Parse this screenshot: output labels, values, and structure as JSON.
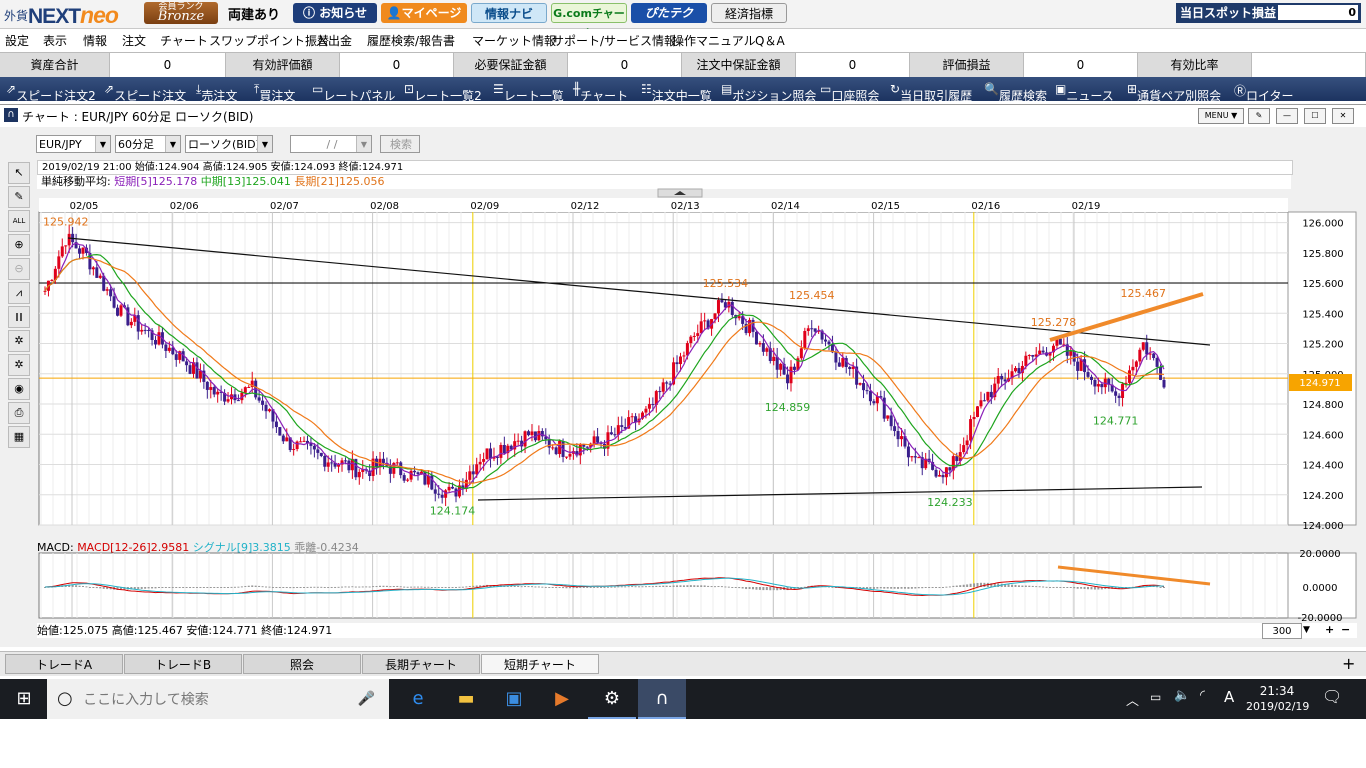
{
  "brand": {
    "prefix": "外貨",
    "name": "NEXT",
    "suffix": "neo",
    "rank_label": "会員ランク",
    "rank": "Bronze"
  },
  "position_state": "両建あり",
  "top_buttons": [
    "お知らせ",
    "マイページ",
    "情報ナビ",
    "G.comチャート",
    "ぴたテク",
    "経済指標"
  ],
  "spot": {
    "label": "当日スポット損益",
    "value": "0"
  },
  "menu": [
    "設定",
    "表示",
    "情報",
    "注文",
    "チャート",
    "スワップポイント振替",
    "入出金",
    "履歴検索/報告書",
    "マーケット情報",
    "サポート/サービス情報",
    "操作マニュアル",
    "Q＆A"
  ],
  "account_info": [
    {
      "label": "資産合計",
      "value": "0"
    },
    {
      "label": "有効評価額",
      "value": "0"
    },
    {
      "label": "必要保証金額",
      "value": "0"
    },
    {
      "label": "注文中保証金額",
      "value": "0"
    },
    {
      "label": "評価損益",
      "value": "0"
    },
    {
      "label": "有効比率",
      "value": ""
    }
  ],
  "toolbar": [
    "スピード注文2",
    "スピード注文",
    "売注文",
    "買注文",
    "レートパネル",
    "レート一覧2",
    "レート一覧",
    "チャート",
    "注文中一覧",
    "ポジション照会",
    "口座照会",
    "当日取引履歴",
    "履歴検索",
    "ニュース",
    "通貨ペア別照会",
    "ロイター"
  ],
  "chart_window": {
    "title": "チャート : EUR/JPY 60分足 ローソク(BID)",
    "menu_btn": "MENU ▼",
    "pair": "EUR/JPY",
    "timeframe": "60分足",
    "chart_type": "ローソク(BID)",
    "date": "/ /",
    "search": "検索",
    "ohlc_line": "2019/02/19 21:00  始値:124.904  高値:124.905  安値:124.093  終値:124.971",
    "ma_label": "単純移動平均:",
    "ma_short": "短期[5]125.178",
    "ma_mid": "中期[13]125.041",
    "ma_long": "長期[21]125.056",
    "macd_label": "MACD:",
    "macd_main": "MACD[12-26]2.9581",
    "macd_signal": "シグナル[9]3.3815",
    "macd_div": "乖離-0.4234",
    "bottom_ohlc": "始値:125.075  高値:125.467  安値:124.771  終値:124.971",
    "bars": "300"
  },
  "chart_data": {
    "type": "candlestick",
    "x_ticks": [
      "02/05",
      "02/06",
      "02/07",
      "02/08",
      "02/09",
      "02/12",
      "02/13",
      "02/14",
      "02/15",
      "02/16",
      "02/19"
    ],
    "y_ticks": [
      "126.000",
      "125.800",
      "125.600",
      "125.400",
      "125.200",
      "125.000",
      "124.800",
      "124.600",
      "124.400",
      "124.200",
      "124.000"
    ],
    "ylim": [
      124.0,
      126.07
    ],
    "current_price": "124.971",
    "annotations": [
      {
        "text": "125.942",
        "color": "#e0731a",
        "kind": "high"
      },
      {
        "text": "125.534",
        "color": "#e0731a",
        "kind": "high"
      },
      {
        "text": "125.454",
        "color": "#e0731a",
        "kind": "high"
      },
      {
        "text": "125.278",
        "color": "#e0731a",
        "kind": "high"
      },
      {
        "text": "125.467",
        "color": "#e0731a",
        "kind": "high"
      },
      {
        "text": "124.174",
        "color": "#2fa32f",
        "kind": "low"
      },
      {
        "text": "124.859",
        "color": "#2fa32f",
        "kind": "low"
      },
      {
        "text": "124.233",
        "color": "#2fa32f",
        "kind": "low"
      },
      {
        "text": "124.771",
        "color": "#2fa32f",
        "kind": "low"
      }
    ],
    "anchors": [
      [
        0,
        125.55
      ],
      [
        6,
        125.9
      ],
      [
        12,
        125.78
      ],
      [
        22,
        125.4
      ],
      [
        40,
        125.1
      ],
      [
        50,
        124.85
      ],
      [
        60,
        124.9
      ],
      [
        70,
        124.55
      ],
      [
        80,
        124.45
      ],
      [
        92,
        124.36
      ],
      [
        98,
        124.4
      ],
      [
        110,
        124.3
      ],
      [
        118,
        124.2
      ],
      [
        126,
        124.45
      ],
      [
        140,
        124.6
      ],
      [
        150,
        124.5
      ],
      [
        162,
        124.55
      ],
      [
        175,
        124.75
      ],
      [
        188,
        125.25
      ],
      [
        197,
        125.48
      ],
      [
        206,
        125.25
      ],
      [
        215,
        124.95
      ],
      [
        222,
        125.35
      ],
      [
        230,
        125.1
      ],
      [
        242,
        124.8
      ],
      [
        252,
        124.4
      ],
      [
        262,
        124.35
      ],
      [
        272,
        124.85
      ],
      [
        282,
        125.05
      ],
      [
        292,
        125.2
      ],
      [
        300,
        125.05
      ],
      [
        310,
        124.85
      ],
      [
        318,
        125.2
      ],
      [
        324,
        124.97
      ]
    ],
    "macd_ticks": [
      "20.0000",
      "0.0000",
      "-20.0000"
    ],
    "colors": {
      "up": "#e0001a",
      "down": "#3a1f8c",
      "ma_short": "#8a1fb8",
      "ma_mid": "#1ea51e",
      "ma_long": "#f07a1a",
      "macd": "#d40000",
      "signal": "#22b2c8",
      "trend_orange": "#f08a2a",
      "price_line": "#f7a400"
    }
  },
  "bottom_tabs": [
    "トレードA",
    "トレードB",
    "照会",
    "長期チャート",
    "短期チャート"
  ],
  "taskbar": {
    "search_placeholder": "ここに入力して検索",
    "time": "21:34",
    "date": "2019/02/19",
    "ime": "A"
  }
}
